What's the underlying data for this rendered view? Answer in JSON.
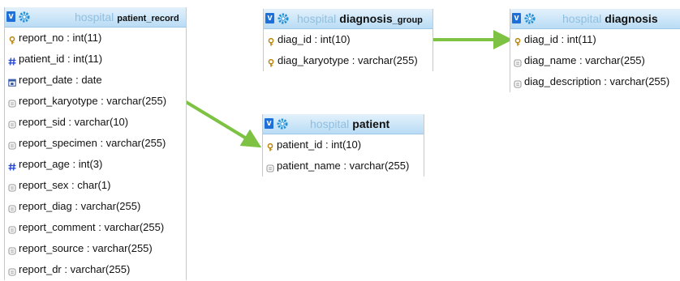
{
  "tables": {
    "patient_record": {
      "db": "hospital",
      "name": "patient_record",
      "fields": [
        {
          "text": "report_no : int(11)",
          "icon": "primary-key-icon"
        },
        {
          "text": "patient_id : int(11)",
          "icon": "numeric-field-icon"
        },
        {
          "text": "report_date : date",
          "icon": "date-field-icon"
        },
        {
          "text": "report_karyotype : varchar(255)",
          "icon": "text-field-icon"
        },
        {
          "text": "report_sid : varchar(10)",
          "icon": "text-field-icon"
        },
        {
          "text": "report_specimen : varchar(255)",
          "icon": "text-field-icon"
        },
        {
          "text": "report_age : int(3)",
          "icon": "numeric-field-icon"
        },
        {
          "text": "report_sex : char(1)",
          "icon": "text-field-icon"
        },
        {
          "text": "report_diag : varchar(255)",
          "icon": "text-field-icon"
        },
        {
          "text": "report_comment : varchar(255)",
          "icon": "text-field-icon"
        },
        {
          "text": "report_source : varchar(255)",
          "icon": "text-field-icon"
        },
        {
          "text": "report_dr : varchar(255)",
          "icon": "text-field-icon"
        }
      ]
    },
    "diagnosis_group": {
      "db": "hospital",
      "name_main": "diagnosis",
      "name_small": "_group",
      "fields": [
        {
          "text": "diag_id : int(10)",
          "icon": "primary-key-icon"
        },
        {
          "text": "diag_karyotype : varchar(255)",
          "icon": "primary-key-icon"
        }
      ]
    },
    "diagnosis": {
      "db": "hospital",
      "name": "diagnosis",
      "fields": [
        {
          "text": "diag_id : int(11)",
          "icon": "primary-key-icon"
        },
        {
          "text": "diag_name : varchar(255)",
          "icon": "text-field-icon"
        },
        {
          "text": "diag_description : varchar(255)",
          "icon": "text-field-icon"
        }
      ]
    },
    "patient": {
      "db": "hospital",
      "name": "patient",
      "fields": [
        {
          "text": "patient_id : int(10)",
          "icon": "primary-key-icon"
        },
        {
          "text": "patient_name : varchar(255)",
          "icon": "text-field-icon"
        }
      ]
    }
  },
  "colors": {
    "arrow": "#7dc242",
    "header_top": "#e3f1fb",
    "header_bottom": "#b9dcf5",
    "db_name": "#8fbfe0",
    "numeric_icon": "#2b4bd1",
    "key_icon": "#b8860b"
  }
}
